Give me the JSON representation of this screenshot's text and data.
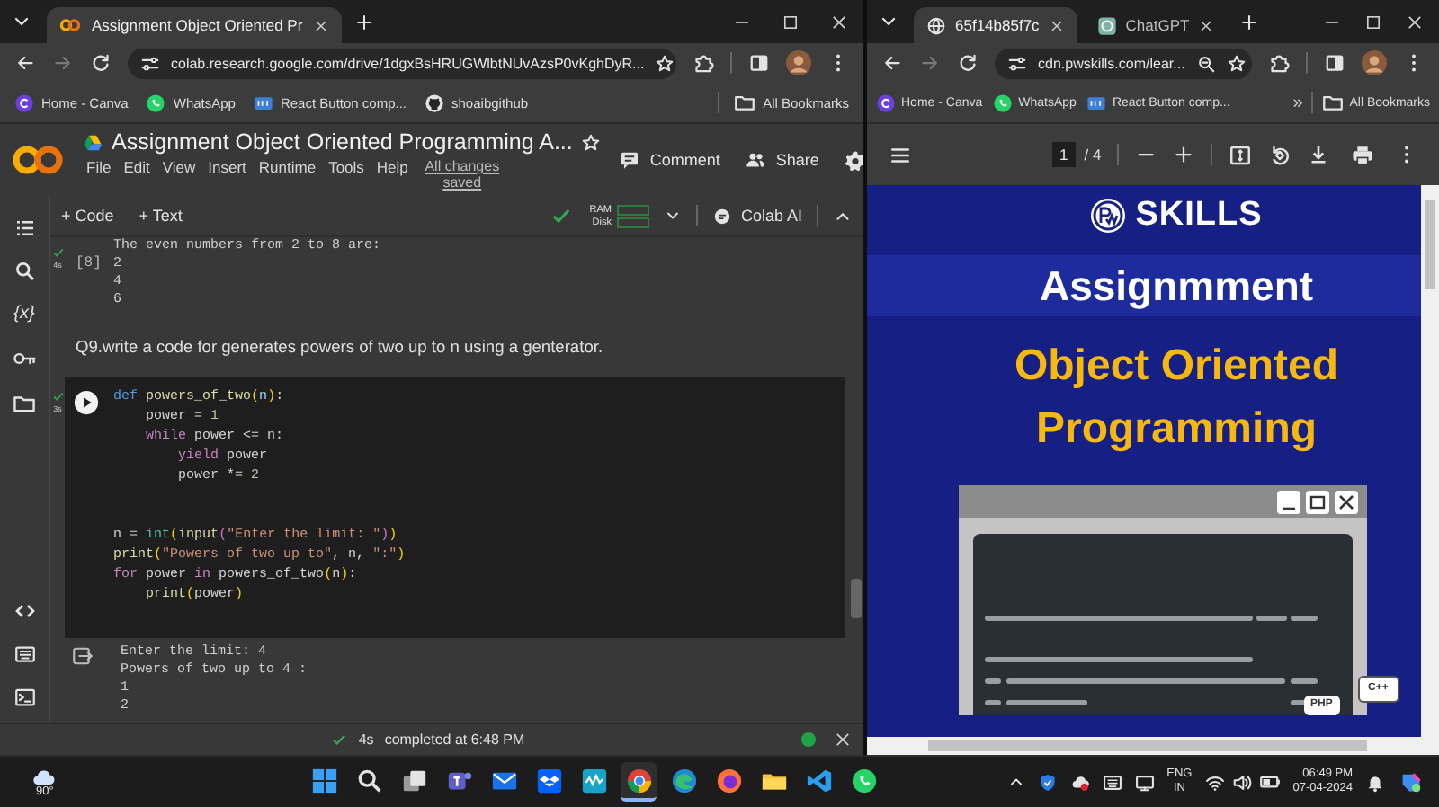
{
  "left_window": {
    "tabs": [
      {
        "title": "Assignment Object Oriented Pr",
        "kind": "colab",
        "selected": true
      }
    ],
    "address": "colab.research.google.com/drive/1dgxBsHRUGWlbtNUvAzsP0vKghDyR...",
    "bookmarks": [
      {
        "kind": "canva",
        "label": "Home - Canva"
      },
      {
        "kind": "whatsapp",
        "label": "WhatsApp"
      },
      {
        "kind": "react",
        "label": "React Button comp..."
      },
      {
        "kind": "github",
        "label": "shoaibgithub"
      }
    ],
    "all_bookmarks": "All Bookmarks",
    "colab": {
      "title": "Assignment Object Oriented Programming A...",
      "menu": [
        "File",
        "Edit",
        "View",
        "Insert",
        "Runtime",
        "Tools",
        "Help"
      ],
      "save_status": "All changes saved",
      "comment": "Comment",
      "share": "Share",
      "add_code": "+ Code",
      "add_text": "+ Text",
      "ram": "RAM",
      "disk": "Disk",
      "colab_ai": "Colab AI",
      "variables_label": "{x}",
      "cells": [
        {
          "kind": "output",
          "duration": "4s",
          "count": "[8]",
          "lines": [
            "The even numbers from 2 to 8 are:",
            "2",
            "4",
            "6"
          ]
        },
        {
          "kind": "text",
          "text": "Q9.write a code for generates powers of two up to n using a genterator."
        },
        {
          "kind": "code",
          "duration": "3s",
          "code_groups": [
            [
              [
                {
                  "text": "def ",
                  "kind": "kw"
                },
                {
                  "text": "powers_of_two",
                  "kind": "fn"
                },
                {
                  "text": "(",
                  "kind": "br"
                },
                {
                  "text": "n",
                  "kind": "param"
                },
                {
                  "text": ")",
                  "kind": "br"
                },
                {
                  "text": ":"
                }
              ],
              [
                {
                  "text": "    power = "
                },
                {
                  "text": "1",
                  "kind": "num"
                }
              ],
              [
                {
                  "text": "    while",
                  "kind": "ctl"
                },
                {
                  "text": " power <= n:"
                }
              ],
              [
                {
                  "text": "        yield",
                  "kind": "ctl"
                },
                {
                  "text": " power"
                }
              ],
              [
                {
                  "text": "        power *= "
                },
                {
                  "text": "2",
                  "kind": "num"
                }
              ]
            ],
            [
              [
                {
                  "text": "n = "
                },
                {
                  "text": "int",
                  "kind": "builtin"
                },
                {
                  "text": "(",
                  "kind": "br"
                },
                {
                  "text": "input",
                  "kind": "fn"
                },
                {
                  "text": "(",
                  "kind": "br2"
                },
                {
                  "text": "\"Enter the limit: \"",
                  "kind": "str"
                },
                {
                  "text": ")",
                  "kind": "br2"
                },
                {
                  "text": ")",
                  "kind": "br"
                }
              ],
              [
                {
                  "text": "print",
                  "kind": "fn"
                },
                {
                  "text": "(",
                  "kind": "br"
                },
                {
                  "text": "\"Powers of two up to\"",
                  "kind": "str"
                },
                {
                  "text": ", n, "
                },
                {
                  "text": "\":\"",
                  "kind": "str"
                },
                {
                  "text": ")",
                  "kind": "br"
                }
              ],
              [
                {
                  "text": "for",
                  "kind": "ctl"
                },
                {
                  "text": " power "
                },
                {
                  "text": "in",
                  "kind": "ctl"
                },
                {
                  "text": " powers_of_two"
                },
                {
                  "text": "(",
                  "kind": "br"
                },
                {
                  "text": "n"
                },
                {
                  "text": ")",
                  "kind": "br"
                },
                {
                  "text": ":"
                }
              ],
              [
                {
                  "text": "    print",
                  "kind": "fn"
                },
                {
                  "text": "(",
                  "kind": "br"
                },
                {
                  "text": "power"
                },
                {
                  "text": ")",
                  "kind": "br"
                }
              ]
            ]
          ],
          "output": [
            "Enter the limit: 4",
            "Powers of two up to 4 :",
            "1",
            "2"
          ]
        }
      ],
      "status": {
        "duration": "4s",
        "text": "completed at 6:48 PM"
      }
    }
  },
  "right_window": {
    "tabs": [
      {
        "title": "65f14b85f7c",
        "kind": "globe",
        "selected": true
      },
      {
        "title": "ChatGPT",
        "kind": "chatgpt",
        "selected": false
      }
    ],
    "address": "cdn.pwskills.com/lear...",
    "bookmarks": [
      {
        "kind": "canva",
        "label": "Home - Canva"
      },
      {
        "kind": "whatsapp",
        "label": "WhatsApp"
      },
      {
        "kind": "react",
        "label": "React Button comp..."
      }
    ],
    "overflow": "»",
    "all_bookmarks": "All Bookmarks",
    "pdf": {
      "page": "1",
      "page_total": "/ 4",
      "logo": "SKILLS",
      "heading": "Assignmment",
      "title": "Object Oriented Programming",
      "badges": [
        {
          "kind": "php",
          "label": "PHP"
        },
        {
          "kind": "cpp",
          "label": "C++"
        }
      ]
    }
  },
  "taskbar": {
    "weather": "90°",
    "apps": [
      {
        "kind": "start",
        "selected": false
      },
      {
        "kind": "search",
        "selected": false
      },
      {
        "kind": "taskview",
        "selected": false
      },
      {
        "kind": "teams",
        "selected": false
      },
      {
        "kind": "mail",
        "selected": false
      },
      {
        "kind": "dropbox",
        "selected": false
      },
      {
        "kind": "wave",
        "selected": false
      },
      {
        "kind": "chrome",
        "selected": true
      },
      {
        "kind": "edge",
        "selected": false
      },
      {
        "kind": "firefox",
        "selected": false
      },
      {
        "kind": "explorer",
        "selected": false
      },
      {
        "kind": "vscode",
        "selected": false
      },
      {
        "kind": "whatsapp",
        "selected": false
      }
    ],
    "language": "ENG",
    "region": "IN",
    "time": "06:49 PM",
    "date": "07-04-2024"
  }
}
